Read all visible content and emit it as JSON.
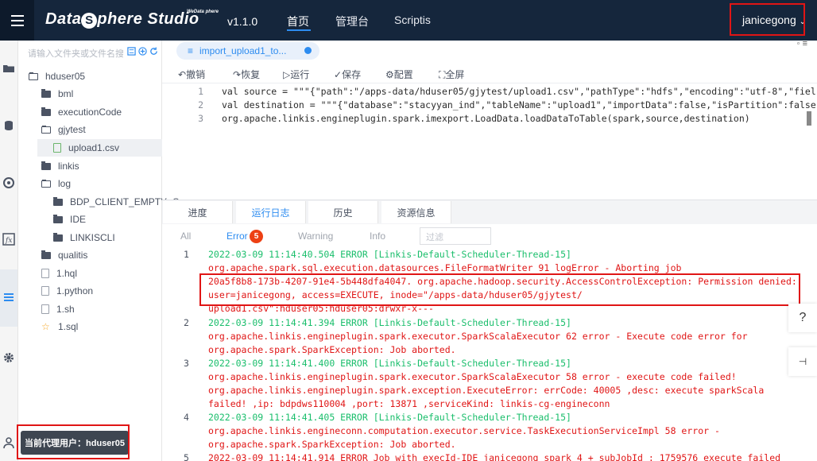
{
  "header": {
    "brand_prefix": "Data",
    "brand_s": "S",
    "brand_suffix": "phere Studio",
    "brand_sup": "WeData phere",
    "version": "v1.1.0",
    "nav": [
      {
        "label": "首页"
      },
      {
        "label": "管理台"
      },
      {
        "label": "Scriptis"
      }
    ],
    "user": "janicegong"
  },
  "filetree": {
    "search_placeholder": "请输入文件夹或文件名搜",
    "items": [
      {
        "label": "hduser05",
        "type": "folder-open"
      },
      {
        "label": "bml",
        "type": "folder"
      },
      {
        "label": "executionCode",
        "type": "folder"
      },
      {
        "label": "gjytest",
        "type": "folder-open"
      },
      {
        "label": "upload1.csv",
        "type": "csv"
      },
      {
        "label": "linkis",
        "type": "folder"
      },
      {
        "label": "log",
        "type": "folder-open"
      },
      {
        "label": "BDP_CLIENT_EMPTY_C",
        "type": "folder"
      },
      {
        "label": "IDE",
        "type": "folder"
      },
      {
        "label": "LINKISCLI",
        "type": "folder"
      },
      {
        "label": "qualitis",
        "type": "folder"
      },
      {
        "label": "1.hql",
        "type": "file"
      },
      {
        "label": "1.python",
        "type": "file"
      },
      {
        "label": "1.sh",
        "type": "file"
      },
      {
        "label": "1.sql",
        "type": "star"
      }
    ],
    "tooltip": "当前代理用户：hduser05"
  },
  "editor": {
    "tab_label": "import_upload1_to...",
    "toolbar": [
      {
        "label": "撤销",
        "icon": "undo-icon",
        "glyph": "↶"
      },
      {
        "label": "恢复",
        "icon": "redo-icon",
        "glyph": "↷"
      },
      {
        "label": "运行",
        "icon": "run-icon",
        "glyph": "▷"
      },
      {
        "label": "保存",
        "icon": "save-icon",
        "glyph": "✓"
      },
      {
        "label": "配置",
        "icon": "config-icon",
        "glyph": "⚙"
      },
      {
        "label": "全屏",
        "icon": "fullscreen-icon",
        "glyph": "⛶"
      }
    ],
    "lines": [
      {
        "num": "1",
        "text": "val source = \"\"\"{\"path\":\"/apps-data/hduser05/gjytest/upload1.csv\",\"pathType\":\"hdfs\",\"encoding\":\"utf-8\",\"fiel"
      },
      {
        "num": "2",
        "text": "val destination = \"\"\"{\"database\":\"stacyyan_ind\",\"tableName\":\"upload1\",\"importData\":false,\"isPartition\":false"
      },
      {
        "num": "3",
        "text": "org.apache.linkis.engineplugin.spark.imexport.LoadData.loadDataToTable(spark,source,destination)"
      }
    ]
  },
  "output": {
    "tabs": [
      {
        "label": "进度"
      },
      {
        "label": "运行日志"
      },
      {
        "label": "历史"
      },
      {
        "label": "资源信息"
      }
    ],
    "filters": [
      {
        "label": "All"
      },
      {
        "label": "Error"
      },
      {
        "label": "Warning"
      },
      {
        "label": "Info"
      }
    ],
    "error_count": "5",
    "filter_placeholder": "过滤",
    "log": [
      {
        "num": "1",
        "text": "2022-03-09 11:14:40.504 ERROR [Linkis-Default-Scheduler-Thread-15]"
      },
      {
        "num": "",
        "text": "org.apache.spark.sql.execution.datasources.FileFormatWriter 91 logError - Aborting job"
      },
      {
        "num": "",
        "text": "20a5f8b8-173b-4207-91e4-5b448dfa4047. org.apache.hadoop.security.AccessControlException: Permission denied:"
      },
      {
        "num": "",
        "text": "user=janicegong, access=EXECUTE, inode=\"/apps-data/hduser05/gjytest/"
      },
      {
        "num": "",
        "text": "upload1.csv\":hduser05:hduser05:drwxr-x---"
      },
      {
        "num": "2",
        "text": "2022-03-09 11:14:41.394 ERROR [Linkis-Default-Scheduler-Thread-15]"
      },
      {
        "num": "",
        "text": "org.apache.linkis.engineplugin.spark.executor.SparkScalaExecutor 62 error - Execute code error for"
      },
      {
        "num": "",
        "text": "org.apache.spark.SparkException: Job aborted."
      },
      {
        "num": "3",
        "text": "2022-03-09 11:14:41.400 ERROR [Linkis-Default-Scheduler-Thread-15]"
      },
      {
        "num": "",
        "text": "org.apache.linkis.engineplugin.spark.executor.SparkScalaExecutor 58 error - execute code failed!"
      },
      {
        "num": "",
        "text": "org.apache.linkis.engineplugin.spark.exception.ExecuteError: errCode: 40005 ,desc: execute sparkScala"
      },
      {
        "num": "",
        "text": "failed! ,ip: bdpdws110004 ,port: 13871 ,serviceKind: linkis-cg-engineconn"
      },
      {
        "num": "4",
        "text": "2022-03-09 11:14:41.405 ERROR [Linkis-Default-Scheduler-Thread-15]"
      },
      {
        "num": "",
        "text": "org.apache.linkis.engineconn.computation.executor.service.TaskExecutionServiceImpl 58 error -"
      },
      {
        "num": "",
        "text": "org.apache.spark.SparkException: Job aborted."
      },
      {
        "num": "5",
        "text": "2022-03-09 11:14:41.914 ERROR Job with execId-IDE_janicegong_spark_4 + subJobId : 1759576 execute failed"
      }
    ]
  },
  "side": {
    "help": "?",
    "collapse": "⊣"
  }
}
